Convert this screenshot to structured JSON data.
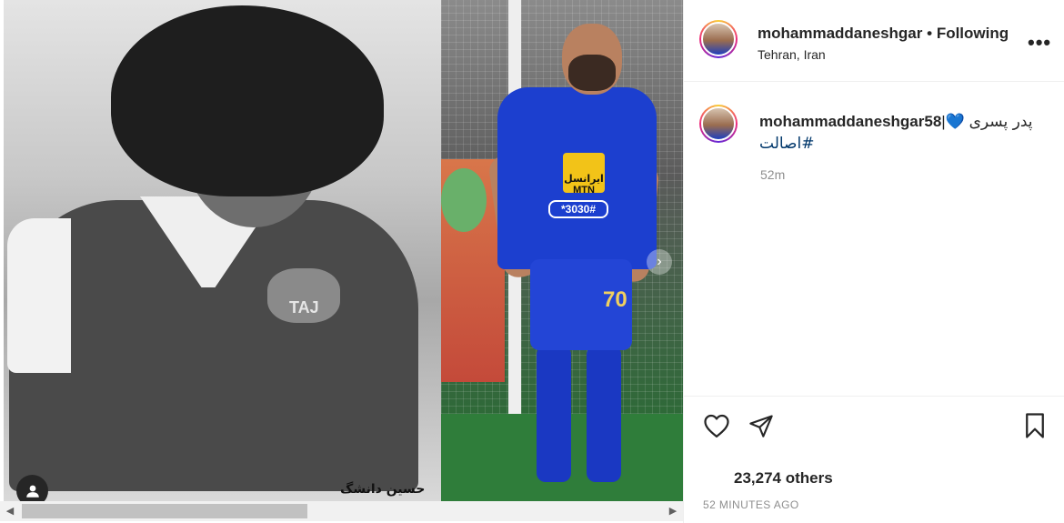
{
  "post": {
    "media": {
      "left_photo_caption": "حسین دانشگ",
      "right_photo_sponsor": "ایرانسل MTN",
      "right_photo_promo": "*3030#",
      "right_photo_number": "70",
      "left_badge_text": "TAJ",
      "next_icon": "chevron-right-icon",
      "user_tag_icon": "user-icon"
    },
    "header": {
      "username": "mohammaddaneshgar",
      "separator": "•",
      "follow_status": "Following",
      "location": "Tehran, Iran",
      "more_icon": "more-horizontal-icon"
    },
    "caption": {
      "username": "mohammaddaneshgar58",
      "heart": "💙",
      "text": "پدر پسری",
      "hashtag": "#اصالت",
      "time": "52m"
    },
    "actions": {
      "icons": [
        "heart-icon",
        "send-icon",
        "bookmark-icon"
      ]
    },
    "likes": "23,274 others",
    "posted_ago": "52 MINUTES AGO",
    "scrollbar": {
      "left_arrow": "◀",
      "right_arrow": "▶"
    }
  }
}
